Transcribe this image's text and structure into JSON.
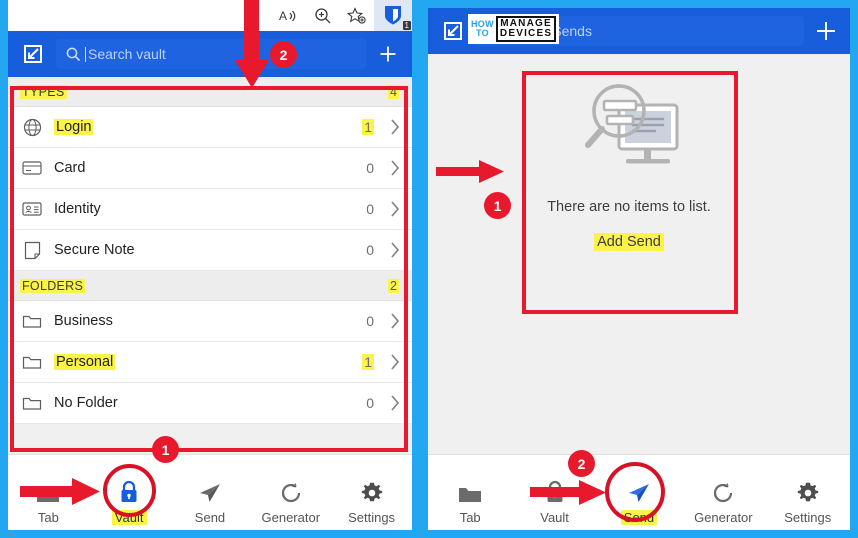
{
  "meta": {
    "accent_blue": "#175ddc",
    "annotation_red": "#e8192c",
    "highlight_yellow": "#fbf34a",
    "frame_cyan": "#22a7f0"
  },
  "watermark": {
    "how": "HOW",
    "to": "TO",
    "manage": "MANAGE",
    "devices": "DEVICES"
  },
  "browser_toolbar": {
    "read_aloud_icon": "read-aloud-icon",
    "zoom_icon": "zoom-in-icon",
    "favorites_icon": "add-favorite-star-icon",
    "extension_icon": "bitwarden-extension-icon",
    "extension_badge": "1"
  },
  "left_panel": {
    "header": {
      "popout_icon": "pop-out-icon",
      "search_icon": "search-icon",
      "search_value": "",
      "search_placeholder": "Search vault",
      "add_icon": "plus-icon"
    },
    "groups": [
      {
        "title": "TYPES",
        "count": "4",
        "title_highlighted": true,
        "count_highlighted": true,
        "rows": [
          {
            "icon": "globe-icon",
            "label": "Login",
            "count": "1",
            "label_highlighted": true,
            "count_highlighted": true
          },
          {
            "icon": "credit-card-icon",
            "label": "Card",
            "count": "0",
            "label_highlighted": false,
            "count_highlighted": false
          },
          {
            "icon": "identity-card-icon",
            "label": "Identity",
            "count": "0",
            "label_highlighted": false,
            "count_highlighted": false
          },
          {
            "icon": "note-icon",
            "label": "Secure Note",
            "count": "0",
            "label_highlighted": false,
            "count_highlighted": false
          }
        ]
      },
      {
        "title": "FOLDERS",
        "count": "2",
        "title_highlighted": true,
        "count_highlighted": true,
        "rows": [
          {
            "icon": "folder-icon",
            "label": "Business",
            "count": "0",
            "label_highlighted": false,
            "count_highlighted": false
          },
          {
            "icon": "folder-icon",
            "label": "Personal",
            "count": "1",
            "label_highlighted": true,
            "count_highlighted": true
          },
          {
            "icon": "folder-icon",
            "label": "No Folder",
            "count": "0",
            "label_highlighted": false,
            "count_highlighted": false
          }
        ]
      }
    ],
    "nav": {
      "active": "Vault",
      "items": [
        {
          "icon": "tab-folder-icon",
          "label": "Tab"
        },
        {
          "icon": "lock-icon",
          "label": "Vault"
        },
        {
          "icon": "paper-plane-icon",
          "label": "Send"
        },
        {
          "icon": "refresh-icon",
          "label": "Generator"
        },
        {
          "icon": "gear-icon",
          "label": "Settings"
        }
      ]
    },
    "annotations": {
      "badge_top": "2",
      "badge_bottom": "1"
    }
  },
  "right_panel": {
    "header": {
      "popout_icon": "pop-out-icon",
      "search_icon": "search-icon",
      "search_value": "",
      "search_placeholder": "Search Sends",
      "add_icon": "plus-icon"
    },
    "empty_state": {
      "illustration": "magnifier-over-monitor-icon",
      "message": "There are no items to list.",
      "action_label": "Add Send",
      "action_highlighted": true
    },
    "nav": {
      "active": "Send",
      "items": [
        {
          "icon": "tab-folder-icon",
          "label": "Tab"
        },
        {
          "icon": "lock-icon",
          "label": "Vault"
        },
        {
          "icon": "paper-plane-icon",
          "label": "Send"
        },
        {
          "icon": "refresh-icon",
          "label": "Generator"
        },
        {
          "icon": "gear-icon",
          "label": "Settings"
        }
      ]
    },
    "annotations": {
      "badge_empty_state": "1",
      "badge_nav": "2"
    }
  }
}
